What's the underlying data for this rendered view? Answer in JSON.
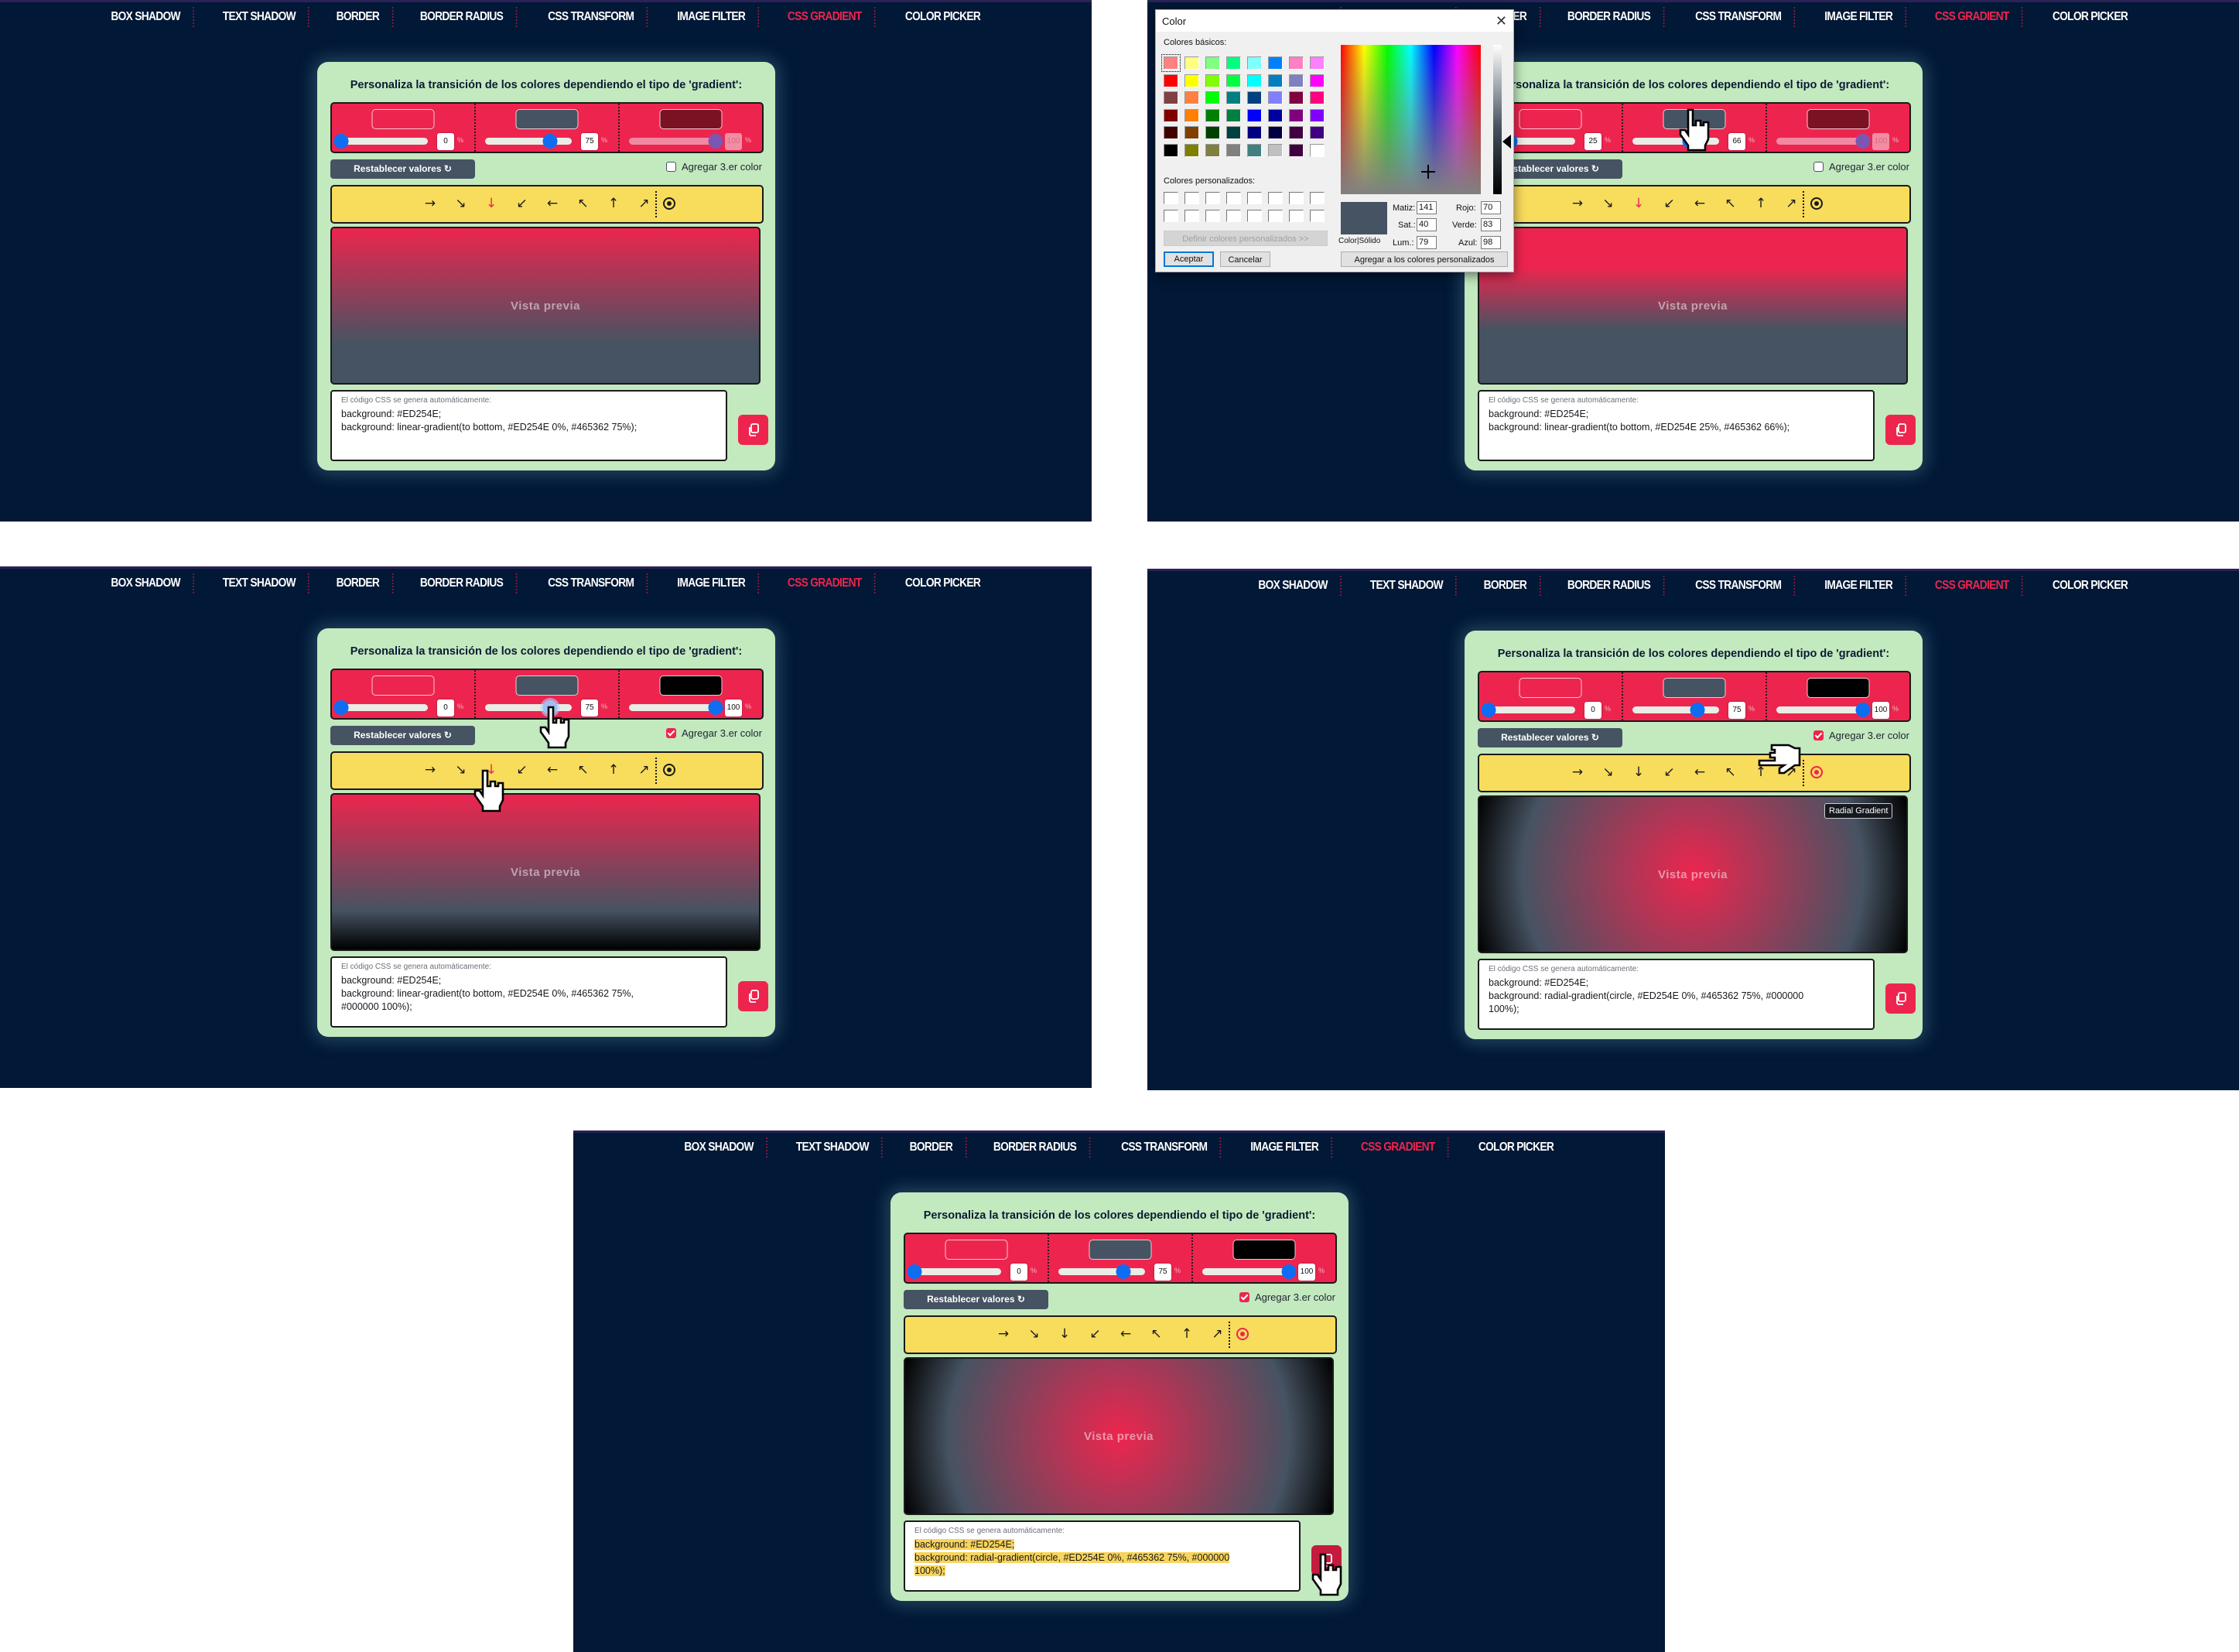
{
  "nav": {
    "items": [
      "BOX SHADOW",
      "TEXT SHADOW",
      "BORDER",
      "BORDER RADIUS",
      "CSS TRANSFORM",
      "IMAGE FILTER",
      "CSS GRADIENT",
      "COLOR PICKER"
    ],
    "active": "CSS GRADIENT"
  },
  "card": {
    "title": "Personaliza la transición de los colores dependiendo el tipo de 'gradient':",
    "reset_label": "Restablecer valores",
    "reset_icon": "refresh-icon",
    "third_color_label": "Agregar 3.er color",
    "directions": [
      {
        "glyph": "→",
        "name": "to right"
      },
      {
        "glyph": "↘",
        "name": "to bottom right"
      },
      {
        "glyph": "↓",
        "name": "to bottom"
      },
      {
        "glyph": "↙",
        "name": "to bottom left"
      },
      {
        "glyph": "←",
        "name": "to left"
      },
      {
        "glyph": "↖",
        "name": "to top left"
      },
      {
        "glyph": "↑",
        "name": "to top"
      },
      {
        "glyph": "↗",
        "name": "to top right"
      }
    ],
    "preview_label": "Vista previa",
    "code_label": "El código CSS se genera automáticamente:",
    "percent_sign": "%",
    "copy_icon": "copy-icon"
  },
  "colors": {
    "c1": "#ED254E",
    "c2": "#465362",
    "c3_dark": "#7A1224",
    "c3": "#000000"
  },
  "panels": [
    {
      "stops": [
        {
          "color": "#ED254E",
          "pct": "0",
          "value": 0
        },
        {
          "color": "#465362",
          "pct": "75",
          "value": 75
        },
        {
          "color": "#7A1224",
          "pct": "100",
          "value": 100,
          "disabled": true
        }
      ],
      "third_color": false,
      "mode": "linear",
      "active_dir": 2,
      "code": [
        "background: #ED254E;",
        "background: linear-gradient(to bottom, #ED254E 0%, #465362 75%);"
      ]
    },
    {
      "stops": [
        {
          "color": "#ED254E",
          "pct": "25",
          "value": 25
        },
        {
          "color": "#465362",
          "pct": "66",
          "value": 66
        },
        {
          "color": "#7A1224",
          "pct": "100",
          "value": 100,
          "disabled": true
        }
      ],
      "third_color": false,
      "mode": "linear",
      "active_dir": 2,
      "code": [
        "background: #ED254E;",
        "background: linear-gradient(to bottom, #ED254E 25%, #465362 66%);"
      ]
    },
    {
      "stops": [
        {
          "color": "#ED254E",
          "pct": "0",
          "value": 0
        },
        {
          "color": "#465362",
          "pct": "75",
          "value": 75
        },
        {
          "color": "#000000",
          "pct": "100",
          "value": 100
        }
      ],
      "third_color": true,
      "mode": "linear",
      "active_dir": 2,
      "code": [
        "background: #ED254E;",
        "background: linear-gradient(to bottom, #ED254E 0%, #465362 75%,",
        "#000000 100%);"
      ]
    },
    {
      "stops": [
        {
          "color": "#ED254E",
          "pct": "0",
          "value": 0
        },
        {
          "color": "#465362",
          "pct": "75",
          "value": 75
        },
        {
          "color": "#000000",
          "pct": "100",
          "value": 100
        }
      ],
      "third_color": true,
      "mode": "radial",
      "active_dir": -1,
      "tooltip": "Radial Gradient",
      "code": [
        "background: #ED254E;",
        "background: radial-gradient(circle, #ED254E 0%, #465362 75%, #000000",
        "100%);"
      ]
    },
    {
      "stops": [
        {
          "color": "#ED254E",
          "pct": "0",
          "value": 0
        },
        {
          "color": "#465362",
          "pct": "75",
          "value": 75
        },
        {
          "color": "#000000",
          "pct": "100",
          "value": 100
        }
      ],
      "third_color": true,
      "mode": "radial",
      "active_dir": -1,
      "code_selected": true,
      "code": [
        "background: #ED254E;",
        "background: radial-gradient(circle, #ED254E 0%, #465362 75%, #000000",
        "100%);"
      ]
    }
  ],
  "color_dialog": {
    "title": "Color",
    "basic_label": "Colores básicos:",
    "custom_label": "Colores personalizados:",
    "define_custom_label": "Definir colores personalizados >>",
    "ok_label": "Aceptar",
    "cancel_label": "Cancelar",
    "add_custom_label": "Agregar a los colores personalizados",
    "solid_label": "Color|Sólido",
    "hue_label": "Matiz:",
    "hue": "141",
    "sat_label": "Sat.:",
    "sat": "40",
    "lum_label": "Lum.:",
    "lum": "79",
    "red_label": "Rojo:",
    "red": "70",
    "green_label": "Verde:",
    "green": "83",
    "blue_label": "Azul:",
    "blue": "98",
    "basic_colors": [
      "#ff8080",
      "#ffff80",
      "#80ff80",
      "#00ff80",
      "#80ffff",
      "#0080ff",
      "#ff80c0",
      "#ff80ff",
      "#ff0000",
      "#ffff00",
      "#80ff00",
      "#00ff40",
      "#00ffff",
      "#0080c0",
      "#8080c0",
      "#ff00ff",
      "#804040",
      "#ff8040",
      "#00ff00",
      "#008080",
      "#004080",
      "#8080ff",
      "#800040",
      "#ff0080",
      "#800000",
      "#ff8000",
      "#008000",
      "#008040",
      "#0000ff",
      "#0000a0",
      "#800080",
      "#8000ff",
      "#400000",
      "#804000",
      "#004000",
      "#004040",
      "#000080",
      "#000040",
      "#400040",
      "#400080",
      "#000000",
      "#808000",
      "#808040",
      "#808080",
      "#408080",
      "#c0c0c0",
      "#400040",
      "#ffffff"
    ]
  }
}
